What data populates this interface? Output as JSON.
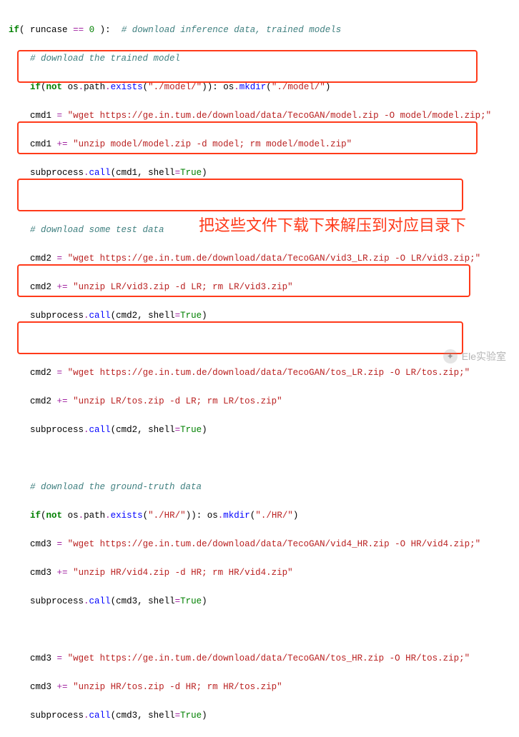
{
  "colors": {
    "keyword": "#008000",
    "operator": "#a020a0",
    "string": "#ba2121",
    "call": "#0000ff",
    "comment": "#408080",
    "highlight_border": "#ff3a1a"
  },
  "annotation": {
    "text": "把这些文件下载下来解压到对应目录下"
  },
  "watermark": {
    "icon_label": "微信",
    "text": "Ele实验室"
  },
  "code": {
    "l01": {
      "if": "if",
      "lp": "(",
      "sp1": " ",
      "v": "runcase",
      "sp2": " ",
      "eq": "==",
      "sp3": " ",
      "zero": "0",
      "sp4": " ",
      "rp": ")",
      "colon": ":",
      "sp5": "  ",
      "c": "# download inference data, trained models"
    },
    "l02": {
      "indent": "    ",
      "c": "# download the trained model"
    },
    "l03": {
      "indent": "    ",
      "if": "if",
      "lp": "(",
      "not": "not",
      "sp": " ",
      "os": "os",
      "d1": ".",
      "path": "path",
      "d2": ".",
      "exists": "exists",
      "lp2": "(",
      "s": "\"./model/\"",
      "rp2": ")",
      "rp": ")",
      "colon": ":",
      "sp2": " ",
      "os2": "os",
      "d3": ".",
      "mkdir": "mkdir",
      "lp3": "(",
      "s2": "\"./model/\"",
      "rp3": ")"
    },
    "l04": {
      "indent": "    ",
      "v": "cmd1",
      "sp": " ",
      "eq": "=",
      "sp2": " ",
      "s": "\"wget https://ge.in.tum.de/download/data/TecoGAN/model.zip -O model/model.zip;\""
    },
    "l05": {
      "indent": "    ",
      "v": "cmd1",
      "sp": " ",
      "eq": "+=",
      "sp2": " ",
      "s": "\"unzip model/model.zip -d model; rm model/model.zip\""
    },
    "l06": {
      "indent": "    ",
      "sub": "subprocess",
      "d": ".",
      "call": "call",
      "lp": "(",
      "a1": "cmd1",
      "comma": ",",
      "sp": " ",
      "kw": "shell",
      "eq": "=",
      "true": "True",
      "rp": ")"
    },
    "l08": {
      "indent": "    ",
      "c": "# download some test data"
    },
    "l09": {
      "indent": "    ",
      "v": "cmd2",
      "sp": " ",
      "eq": "=",
      "sp2": " ",
      "s": "\"wget https://ge.in.tum.de/download/data/TecoGAN/vid3_LR.zip -O LR/vid3.zip;\""
    },
    "l10": {
      "indent": "    ",
      "v": "cmd2",
      "sp": " ",
      "eq": "+=",
      "sp2": " ",
      "s": "\"unzip LR/vid3.zip -d LR; rm LR/vid3.zip\""
    },
    "l11": {
      "indent": "    ",
      "sub": "subprocess",
      "d": ".",
      "call": "call",
      "lp": "(",
      "a1": "cmd2",
      "comma": ",",
      "sp": " ",
      "kw": "shell",
      "eq": "=",
      "true": "True",
      "rp": ")"
    },
    "l13": {
      "indent": "    ",
      "v": "cmd2",
      "sp": " ",
      "eq": "=",
      "sp2": " ",
      "s": "\"wget https://ge.in.tum.de/download/data/TecoGAN/tos_LR.zip -O LR/tos.zip;\""
    },
    "l14": {
      "indent": "    ",
      "v": "cmd2",
      "sp": " ",
      "eq": "+=",
      "sp2": " ",
      "s": "\"unzip LR/tos.zip -d LR; rm LR/tos.zip\""
    },
    "l15": {
      "indent": "    ",
      "sub": "subprocess",
      "d": ".",
      "call": "call",
      "lp": "(",
      "a1": "cmd2",
      "comma": ",",
      "sp": " ",
      "kw": "shell",
      "eq": "=",
      "true": "True",
      "rp": ")"
    },
    "l17": {
      "indent": "    ",
      "c": "# download the ground-truth data"
    },
    "l18": {
      "indent": "    ",
      "if": "if",
      "lp": "(",
      "not": "not",
      "sp": " ",
      "os": "os",
      "d1": ".",
      "path": "path",
      "d2": ".",
      "exists": "exists",
      "lp2": "(",
      "s": "\"./HR/\"",
      "rp2": ")",
      "rp": ")",
      "colon": ":",
      "sp2": " ",
      "os2": "os",
      "d3": ".",
      "mkdir": "mkdir",
      "lp3": "(",
      "s2": "\"./HR/\"",
      "rp3": ")"
    },
    "l19": {
      "indent": "    ",
      "v": "cmd3",
      "sp": " ",
      "eq": "=",
      "sp2": " ",
      "s": "\"wget https://ge.in.tum.de/download/data/TecoGAN/vid4_HR.zip -O HR/vid4.zip;\""
    },
    "l20": {
      "indent": "    ",
      "v": "cmd3",
      "sp": " ",
      "eq": "+=",
      "sp2": " ",
      "s": "\"unzip HR/vid4.zip -d HR; rm HR/vid4.zip\""
    },
    "l21": {
      "indent": "    ",
      "sub": "subprocess",
      "d": ".",
      "call": "call",
      "lp": "(",
      "a1": "cmd3",
      "comma": ",",
      "sp": " ",
      "kw": "shell",
      "eq": "=",
      "true": "True",
      "rp": ")"
    },
    "l23": {
      "indent": "    ",
      "v": "cmd3",
      "sp": " ",
      "eq": "=",
      "sp2": " ",
      "s": "\"wget https://ge.in.tum.de/download/data/TecoGAN/tos_HR.zip -O HR/tos.zip;\""
    },
    "l24": {
      "indent": "    ",
      "v": "cmd3",
      "sp": " ",
      "eq": "+=",
      "sp2": " ",
      "s": "\"unzip HR/tos.zip -d HR; rm HR/tos.zip\""
    },
    "l25": {
      "indent": "    ",
      "sub": "subprocess",
      "d": ".",
      "call": "call",
      "lp": "(",
      "a1": "cmd3",
      "comma": ",",
      "sp": " ",
      "kw": "shell",
      "eq": "=",
      "true": "True",
      "rp": ")"
    }
  }
}
